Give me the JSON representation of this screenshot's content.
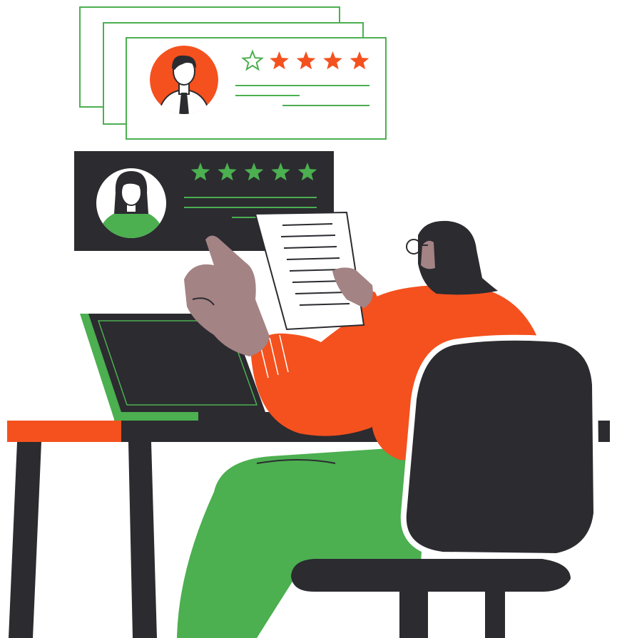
{
  "colors": {
    "green": "#4caf50",
    "orange": "#f4511e",
    "dark": "#2b2b30",
    "skin": "#a48384",
    "paper": "#ffffff"
  },
  "reviews": [
    {
      "avatar": "man-avatar-icon",
      "rating_filled": 4,
      "rating_max": 5,
      "style": "outlined"
    },
    {
      "avatar": "woman-avatar-icon",
      "rating_filled": 5,
      "rating_max": 5,
      "style": "dark"
    }
  ],
  "icons": [
    "star-icon",
    "man-avatar-icon",
    "woman-avatar-icon",
    "laptop-icon",
    "document-icon",
    "office-chair-icon",
    "desk-icon"
  ]
}
